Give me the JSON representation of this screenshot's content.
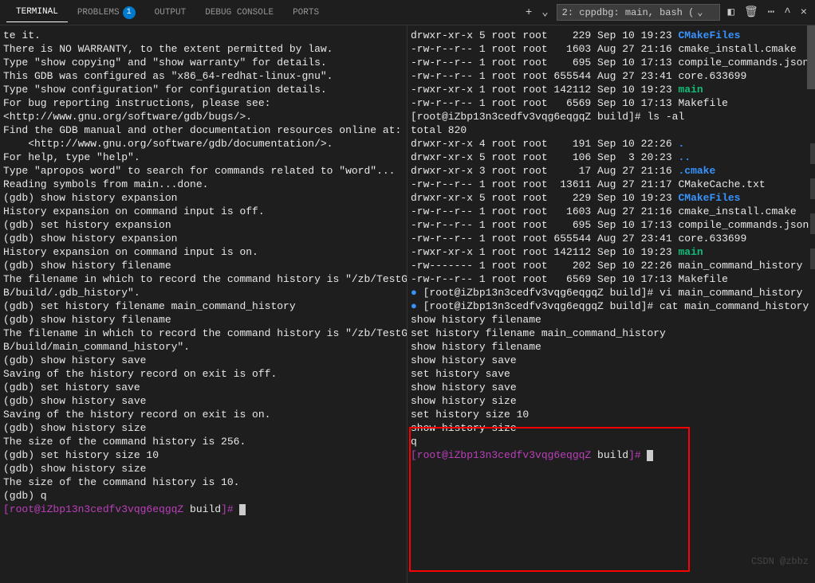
{
  "tabs": {
    "terminal": "TERMINAL",
    "problems": "PROBLEMS",
    "problems_count": "1",
    "output": "OUTPUT",
    "debug": "DEBUG CONSOLE",
    "ports": "PORTS"
  },
  "toolbar": {
    "session_label": "2: cppdbg: main, bash (",
    "plus": "+",
    "chevron": "⌄",
    "split": "◧",
    "trash": "🗑",
    "more": "⋯",
    "caret_up": "^",
    "close": "×"
  },
  "left_pane": [
    {
      "t": "te it.",
      "cls": ""
    },
    {
      "t": "There is NO WARRANTY, to the extent permitted by law.",
      "cls": ""
    },
    {
      "t": "Type \"show copying\" and \"show warranty\" for details.",
      "cls": ""
    },
    {
      "t": "This GDB was configured as \"x86_64-redhat-linux-gnu\".",
      "cls": ""
    },
    {
      "t": "Type \"show configuration\" for configuration details.",
      "cls": ""
    },
    {
      "t": "For bug reporting instructions, please see:",
      "cls": ""
    },
    {
      "t": "<http://www.gnu.org/software/gdb/bugs/>.",
      "cls": ""
    },
    {
      "t": "Find the GDB manual and other documentation resources online at:",
      "cls": ""
    },
    {
      "t": "    <http://www.gnu.org/software/gdb/documentation/>.",
      "cls": ""
    },
    {
      "t": "",
      "cls": ""
    },
    {
      "t": "For help, type \"help\".",
      "cls": ""
    },
    {
      "t": "Type \"apropos word\" to search for commands related to \"word\"...",
      "cls": ""
    },
    {
      "t": "Reading symbols from main...done.",
      "cls": ""
    },
    {
      "t": "(gdb) show history expansion",
      "cls": ""
    },
    {
      "t": "History expansion on command input is off.",
      "cls": ""
    },
    {
      "t": "(gdb) set history expansion",
      "cls": ""
    },
    {
      "t": "(gdb) show history expansion",
      "cls": ""
    },
    {
      "t": "History expansion on command input is on.",
      "cls": ""
    },
    {
      "t": "(gdb) show history filename",
      "cls": ""
    },
    {
      "t": "The filename in which to record the command history is \"/zb/TestGDB/build/.gdb_history\".",
      "cls": ""
    },
    {
      "t": "(gdb) set history filename main_command_history",
      "cls": ""
    },
    {
      "t": "(gdb) show history filename",
      "cls": ""
    },
    {
      "t": "The filename in which to record the command history is \"/zb/TestGDB/build/main_command_history\".",
      "cls": ""
    },
    {
      "t": "(gdb) show history save",
      "cls": ""
    },
    {
      "t": "Saving of the history record on exit is off.",
      "cls": ""
    },
    {
      "t": "(gdb) set history save",
      "cls": ""
    },
    {
      "t": "(gdb) show history save",
      "cls": ""
    },
    {
      "t": "Saving of the history record on exit is on.",
      "cls": ""
    },
    {
      "t": "(gdb) show history size",
      "cls": ""
    },
    {
      "t": "The size of the command history is 256.",
      "cls": ""
    },
    {
      "t": "(gdb) set history size 10",
      "cls": ""
    },
    {
      "t": "(gdb) show history size",
      "cls": ""
    },
    {
      "t": "The size of the command history is 10.",
      "cls": ""
    },
    {
      "t": "(gdb) q",
      "cls": ""
    }
  ],
  "left_prompt": {
    "prefix": "[root@iZbp13n3cedfv3vqg6eqgqZ ",
    "dir": "build",
    "suffix": "]#"
  },
  "right_lines": [
    {
      "frag": [
        {
          "t": "drwxr-xr-x 5 root root    229 Sep 10 19:23 "
        },
        {
          "t": "CMakeFiles",
          "cls": "c-blue"
        }
      ]
    },
    {
      "frag": [
        {
          "t": "-rw-r--r-- 1 root root   1603 Aug 27 21:16 cmake_install.cmake"
        }
      ]
    },
    {
      "frag": [
        {
          "t": "-rw-r--r-- 1 root root    695 Sep 10 17:13 compile_commands.json"
        }
      ]
    },
    {
      "frag": [
        {
          "t": "-rw-r--r-- 1 root root 655544 Aug 27 23:41 core.633699"
        }
      ]
    },
    {
      "frag": [
        {
          "t": "-rwxr-xr-x 1 root root 142112 Sep 10 19:23 "
        },
        {
          "t": "main",
          "cls": "c-green"
        }
      ]
    },
    {
      "frag": [
        {
          "t": "-rw-r--r-- 1 root root   6569 Sep 10 17:13 Makefile"
        }
      ]
    },
    {
      "frag": [
        {
          "t": "[root@iZbp13n3cedfv3vqg6eqgqZ build]# ls -al"
        }
      ]
    },
    {
      "frag": [
        {
          "t": "total 820"
        }
      ]
    },
    {
      "frag": [
        {
          "t": "drwxr-xr-x 4 root root    191 Sep 10 22:26 "
        },
        {
          "t": ".",
          "cls": "c-blue"
        }
      ]
    },
    {
      "frag": [
        {
          "t": "drwxr-xr-x 5 root root    106 Sep  3 20:23 "
        },
        {
          "t": "..",
          "cls": "c-blue"
        }
      ]
    },
    {
      "frag": [
        {
          "t": "drwxr-xr-x 3 root root     17 Aug 27 21:16 "
        },
        {
          "t": ".cmake",
          "cls": "c-blue"
        }
      ]
    },
    {
      "frag": [
        {
          "t": "-rw-r--r-- 1 root root  13611 Aug 27 21:17 CMakeCache.txt"
        }
      ]
    },
    {
      "frag": [
        {
          "t": "drwxr-xr-x 5 root root    229 Sep 10 19:23 "
        },
        {
          "t": "CMakeFiles",
          "cls": "c-blue"
        }
      ]
    },
    {
      "frag": [
        {
          "t": "-rw-r--r-- 1 root root   1603 Aug 27 21:16 cmake_install.cmake"
        }
      ]
    },
    {
      "frag": [
        {
          "t": "-rw-r--r-- 1 root root    695 Sep 10 17:13 compile_commands.json"
        }
      ]
    },
    {
      "frag": [
        {
          "t": "-rw-r--r-- 1 root root 655544 Aug 27 23:41 core.633699"
        }
      ]
    },
    {
      "frag": [
        {
          "t": "-rwxr-xr-x 1 root root 142112 Sep 10 19:23 "
        },
        {
          "t": "main",
          "cls": "c-green"
        }
      ]
    },
    {
      "frag": [
        {
          "t": "-rw------- 1 root root    202 Sep 10 22:26 main_command_history"
        }
      ]
    },
    {
      "frag": [
        {
          "t": "-rw-r--r-- 1 root root   6569 Sep 10 17:13 Makefile"
        }
      ]
    },
    {
      "frag": [
        {
          "t": "[root@iZbp13n3cedfv3vqg6eqgqZ build]# vi main_command_history"
        }
      ],
      "dot": true
    },
    {
      "frag": [
        {
          "t": "[root@iZbp13n3cedfv3vqg6eqgqZ build]# cat main_command_history"
        }
      ],
      "dot": true
    },
    {
      "frag": [
        {
          "t": "show history filename"
        }
      ]
    },
    {
      "frag": [
        {
          "t": "set history filename main_command_history"
        }
      ]
    },
    {
      "frag": [
        {
          "t": "show history filename"
        }
      ]
    },
    {
      "frag": [
        {
          "t": "show history save"
        }
      ]
    },
    {
      "frag": [
        {
          "t": "set history save"
        }
      ]
    },
    {
      "frag": [
        {
          "t": "show history save"
        }
      ]
    },
    {
      "frag": [
        {
          "t": "show history size"
        }
      ]
    },
    {
      "frag": [
        {
          "t": "set history size 10"
        }
      ]
    },
    {
      "frag": [
        {
          "t": "show history size"
        }
      ]
    },
    {
      "frag": [
        {
          "t": "q"
        }
      ]
    }
  ],
  "right_prompt": {
    "prefix": "[root@iZbp13n3cedfv3vqg6eqgqZ ",
    "dir": "build",
    "suffix": "]#"
  },
  "watermark": "CSDN @zbbz"
}
